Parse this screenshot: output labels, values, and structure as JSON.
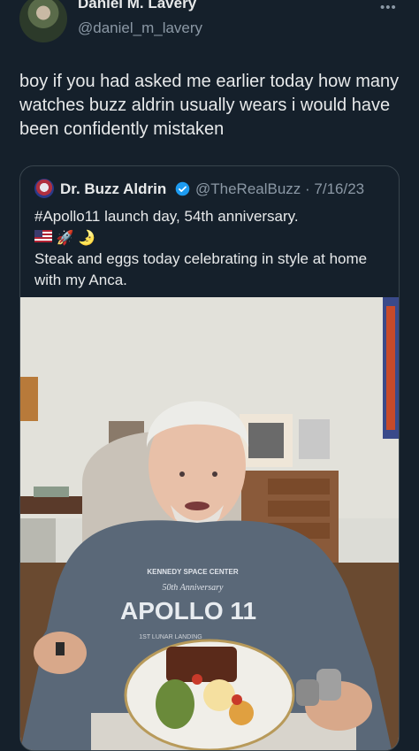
{
  "tweet": {
    "author_name": "Daniel M. Lavery",
    "author_handle": "@daniel_m_lavery",
    "more_label": "•••",
    "text": "boy if you had asked me earlier today how many watches buzz aldrin usually wears i would have been confidently mistaken"
  },
  "quote": {
    "author_name": "Dr. Buzz Aldrin",
    "handle_date": "@TheRealBuzz · 7/16/23",
    "line1": "#Apollo11 launch day, 54th anniversary.",
    "emojis": [
      "flag-us",
      "rocket",
      "moon"
    ],
    "rocket_glyph": "🚀",
    "moon_glyph": "🌛",
    "line2": "Steak and eggs today celebrating in style at home with my Anca.",
    "photo": {
      "shirt_line1": "KENNEDY SPACE CENTER",
      "shirt_line2": "50th Anniversary",
      "shirt_line3": "APOLLO 11",
      "shirt_line4": "1ST LUNAR LANDING"
    }
  },
  "colors": {
    "background": "#15202b",
    "text": "#e7e9ea",
    "muted": "#8b98a5",
    "verified": "#1d9bf0",
    "border": "#38444d"
  }
}
